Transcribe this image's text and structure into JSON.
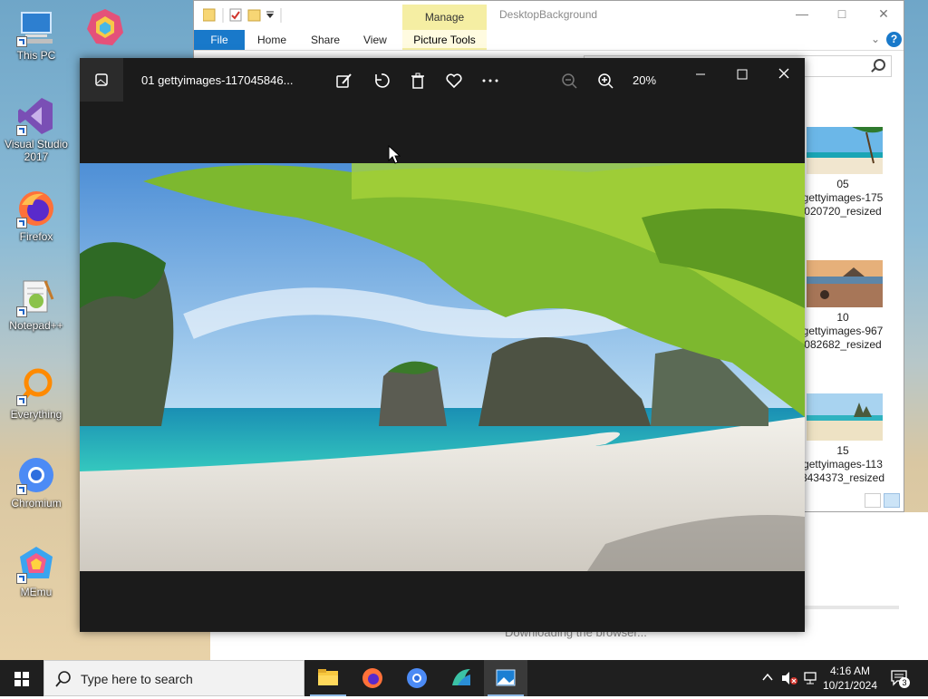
{
  "desktop": {
    "icons": [
      {
        "label": "This PC",
        "icon": "computer-icon"
      },
      {
        "label": "Visual Studio 2017",
        "icon": "visual-studio-icon"
      },
      {
        "label": "Firefox",
        "icon": "firefox-icon"
      },
      {
        "label": "Notepad++",
        "icon": "notepadpp-icon"
      },
      {
        "label": "Everything",
        "icon": "everything-icon"
      },
      {
        "label": "Chromium",
        "icon": "chromium-icon"
      },
      {
        "label": "MEmu",
        "icon": "memu-icon"
      }
    ]
  },
  "explorer": {
    "title": "DesktopBackground",
    "manage_label": "Manage",
    "ribbon_tabs": [
      "File",
      "Home",
      "Share",
      "View",
      "Picture Tools"
    ],
    "files": [
      {
        "label": "05\ngettyimages-175\n020720_resized"
      },
      {
        "label": "10\ngettyimages-967\n082682_resized"
      },
      {
        "label": "15\ngettyimages-113\n8434373_resized"
      }
    ]
  },
  "viewer": {
    "filename": "01 gettyimages-117045846...",
    "zoom": "20%"
  },
  "browser": {
    "status": "Downloading the browser..."
  },
  "taskbar": {
    "search_placeholder": "Type here to search",
    "time": "4:16 AM",
    "date": "10/21/2024",
    "notifications": "3",
    "apps": [
      "file-explorer",
      "firefox",
      "chromium",
      "memu",
      "photos"
    ]
  },
  "colors": {
    "accent": "#1979ca",
    "viewer_bg": "#1b1b1b",
    "taskbar_bg": "#1f1f1f",
    "manage_tab": "#f5eea3"
  }
}
